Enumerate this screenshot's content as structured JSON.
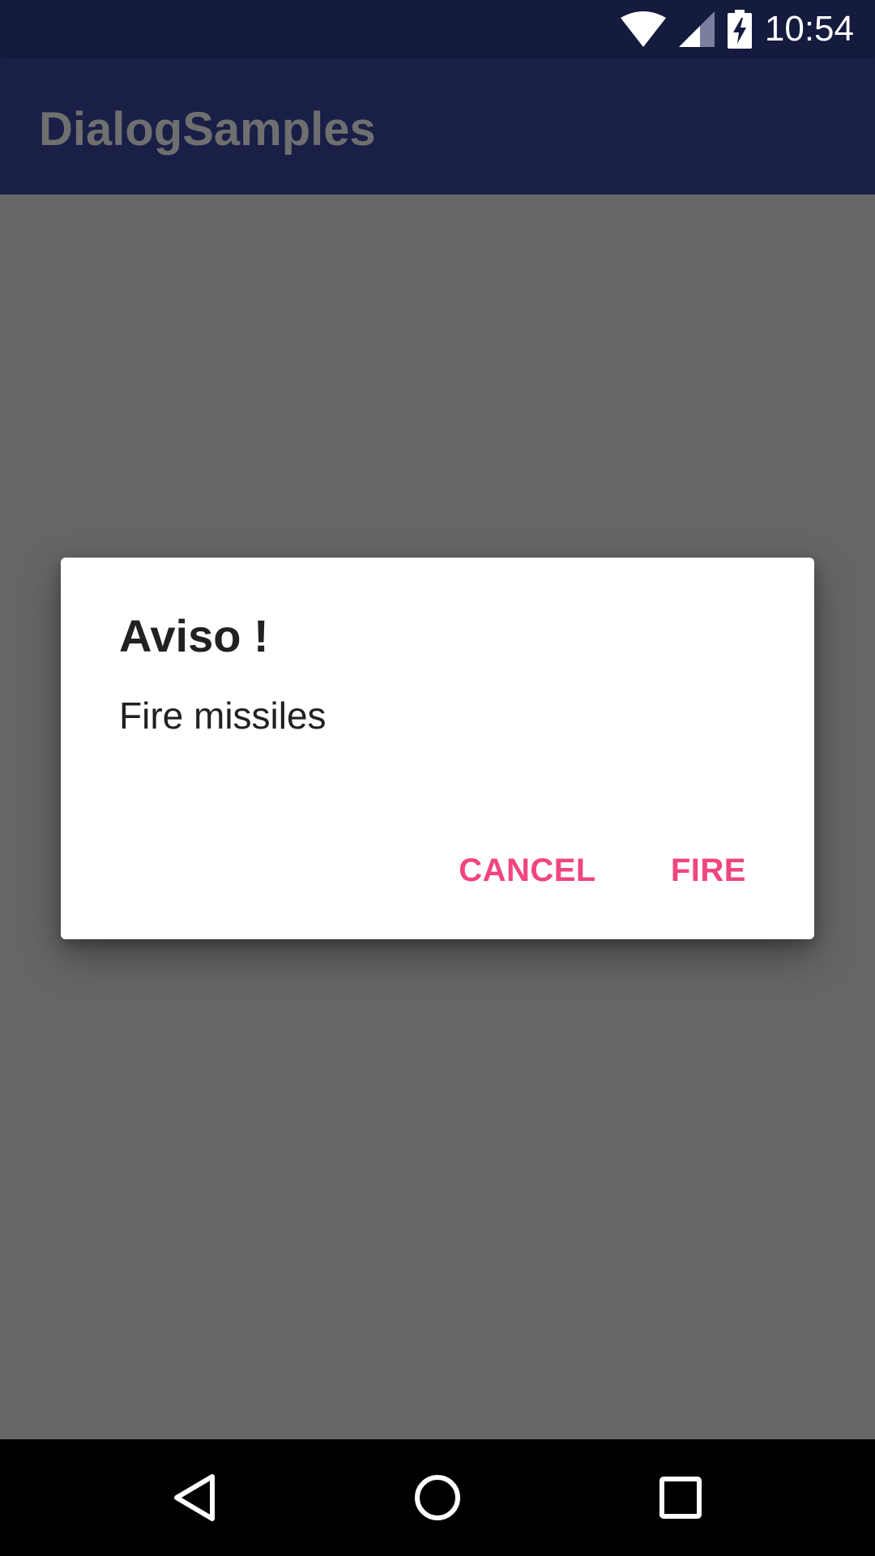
{
  "status_bar": {
    "time": "10:54",
    "icons": [
      "wifi-icon",
      "signal-icon",
      "battery-charging-icon"
    ]
  },
  "app_bar": {
    "title": "DialogSamples"
  },
  "dialog": {
    "title": "Aviso !",
    "message": "Fire missiles",
    "buttons": {
      "cancel": "CANCEL",
      "fire": "FIRE"
    },
    "accent_color": "#f0457e"
  },
  "nav_bar": {
    "icons": [
      "back-icon",
      "home-icon",
      "recents-icon"
    ]
  },
  "colors": {
    "status_bar": "#151a3f",
    "app_bar": "#1a1f48",
    "scrim": "#666666",
    "dialog_bg": "#ffffff",
    "nav_bar": "#000000"
  }
}
